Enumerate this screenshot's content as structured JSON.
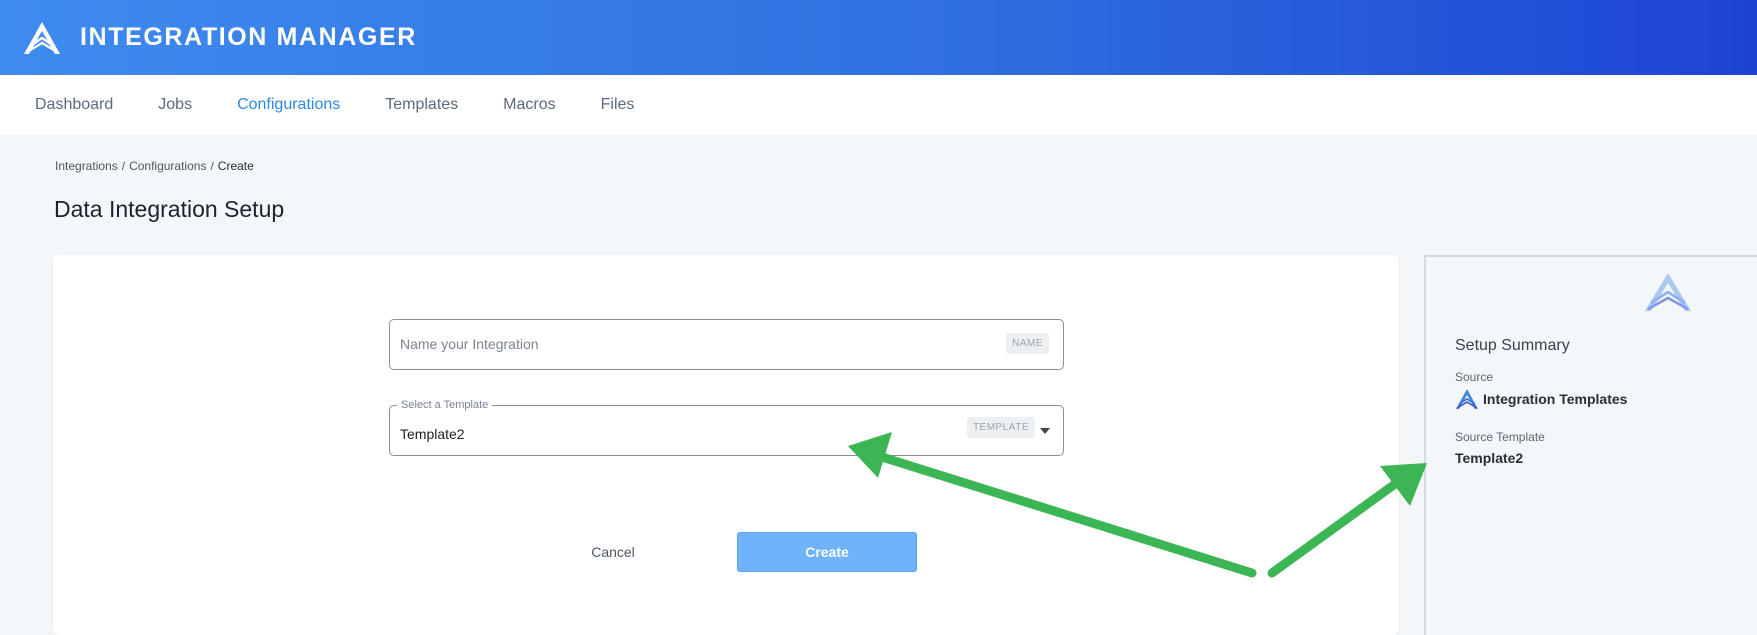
{
  "header": {
    "app_title": "INTEGRATION MANAGER",
    "logo_icon": "mountain-logo-icon"
  },
  "nav": {
    "items": [
      {
        "label": "Dashboard",
        "active": false
      },
      {
        "label": "Jobs",
        "active": false
      },
      {
        "label": "Configurations",
        "active": true
      },
      {
        "label": "Templates",
        "active": false
      },
      {
        "label": "Macros",
        "active": false
      },
      {
        "label": "Files",
        "active": false
      }
    ]
  },
  "breadcrumb": {
    "items": [
      "Integrations",
      "Configurations",
      "Create"
    ],
    "separator": "/"
  },
  "page": {
    "title": "Data Integration Setup"
  },
  "form": {
    "name_field": {
      "placeholder": "Name your Integration",
      "tag": "NAME",
      "value": ""
    },
    "template_field": {
      "label": "Select a Template",
      "value": "Template2",
      "tag": "TEMPLATE"
    },
    "cancel_label": "Cancel",
    "create_label": "Create"
  },
  "summary": {
    "title": "Setup Summary",
    "source_label": "Source",
    "source_value": "Integration Templates",
    "template_label": "Source Template",
    "template_value": "Template2"
  },
  "colors": {
    "header_gradient_start": "#3e8bef",
    "header_gradient_end": "#1c44d3",
    "nav_active": "#2a8ae0",
    "create_button": "#6eb3fb",
    "annotation_arrow": "#3cb554"
  }
}
